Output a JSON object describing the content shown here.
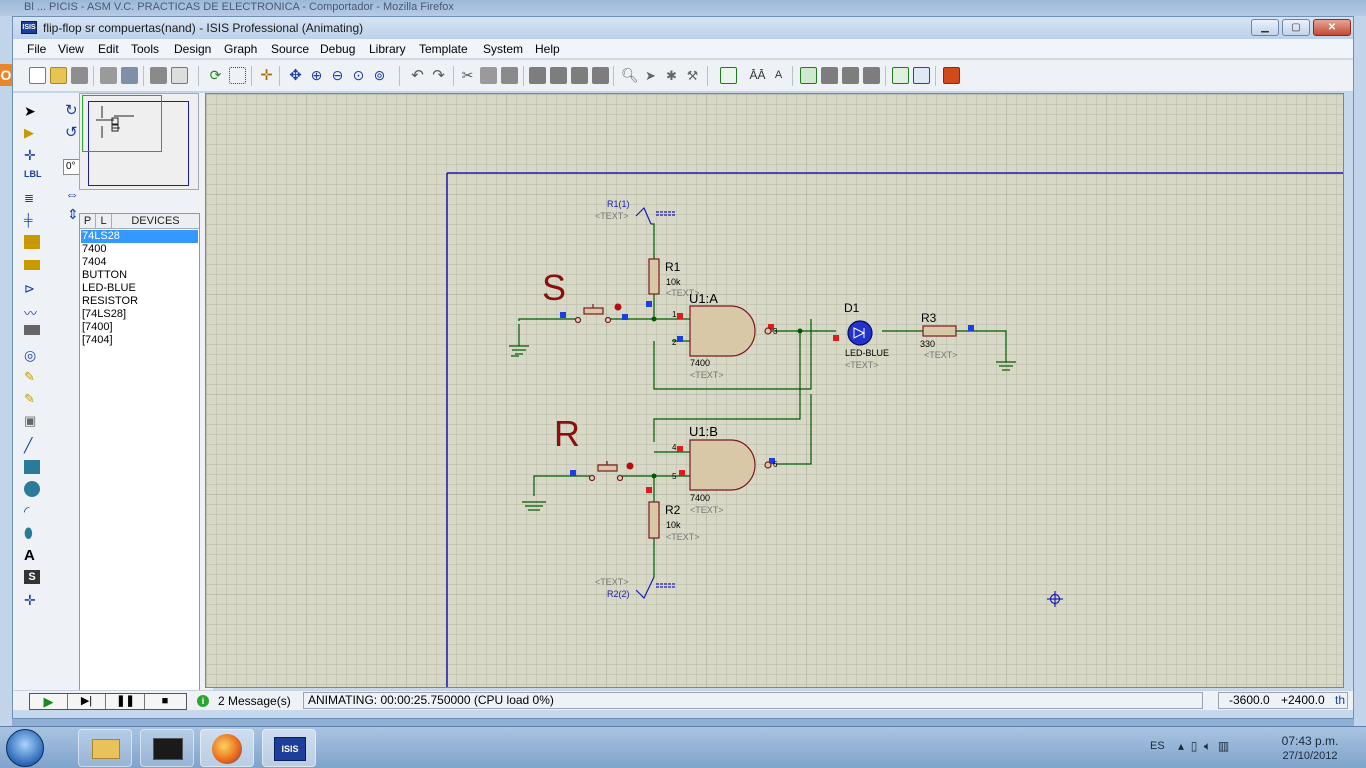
{
  "background_window": {
    "title_fragment": "Bl ... PICIS - ASM V.C. PRACTICAS DE ELECTRONICA - Comportador - Mozilla Firefox"
  },
  "window": {
    "title": "flip-flop sr compuertas(nand) - ISIS Professional (Animating)",
    "icon_text": "ISIS"
  },
  "menu": [
    "File",
    "View",
    "Edit",
    "Tools",
    "Design",
    "Graph",
    "Source",
    "Debug",
    "Library",
    "Template",
    "System",
    "Help"
  ],
  "panel": {
    "rotation_value": "0°",
    "tabs": [
      "P",
      "L",
      "DEVICES"
    ],
    "devices": [
      "74LS28",
      "7400",
      "7404",
      "BUTTON",
      "LED-BLUE",
      "RESISTOR",
      "[74LS28]",
      "[7400]",
      "[7404]"
    ],
    "selected_index": 0
  },
  "schematic": {
    "label_s": "S",
    "label_r": "R",
    "u1a": {
      "ref": "U1:A",
      "part": "7400",
      "text": "<TEXT>",
      "pin1": "1",
      "pin2": "2",
      "pin3": "3"
    },
    "u1b": {
      "ref": "U1:B",
      "part": "7400",
      "text": "<TEXT>",
      "pin4": "4",
      "pin5": "5",
      "pin6": "6"
    },
    "r1": {
      "ref": "R1",
      "value": "10k",
      "text": "<TEXT>"
    },
    "r2": {
      "ref": "R2",
      "value": "10k",
      "text": "<TEXT>"
    },
    "r3": {
      "ref": "R3",
      "value": "330",
      "text": "<TEXT>"
    },
    "d1": {
      "ref": "D1",
      "part": "LED-BLUE",
      "text": "<TEXT>"
    },
    "term1": {
      "name": "R1(1)",
      "text": "<TEXT>"
    },
    "term2": {
      "name": "R2(2)",
      "text": "<TEXT>"
    }
  },
  "status": {
    "messages": "2 Message(s)",
    "animation": "ANIMATING: 00:00:25.750000 (CPU load 0%)",
    "coord_x": "-3600.0",
    "coord_y": "+2400.0",
    "unit": "th"
  },
  "taskbar": {
    "lang": "ES",
    "time": "07:43 p.m.",
    "date": "27/10/2012"
  }
}
